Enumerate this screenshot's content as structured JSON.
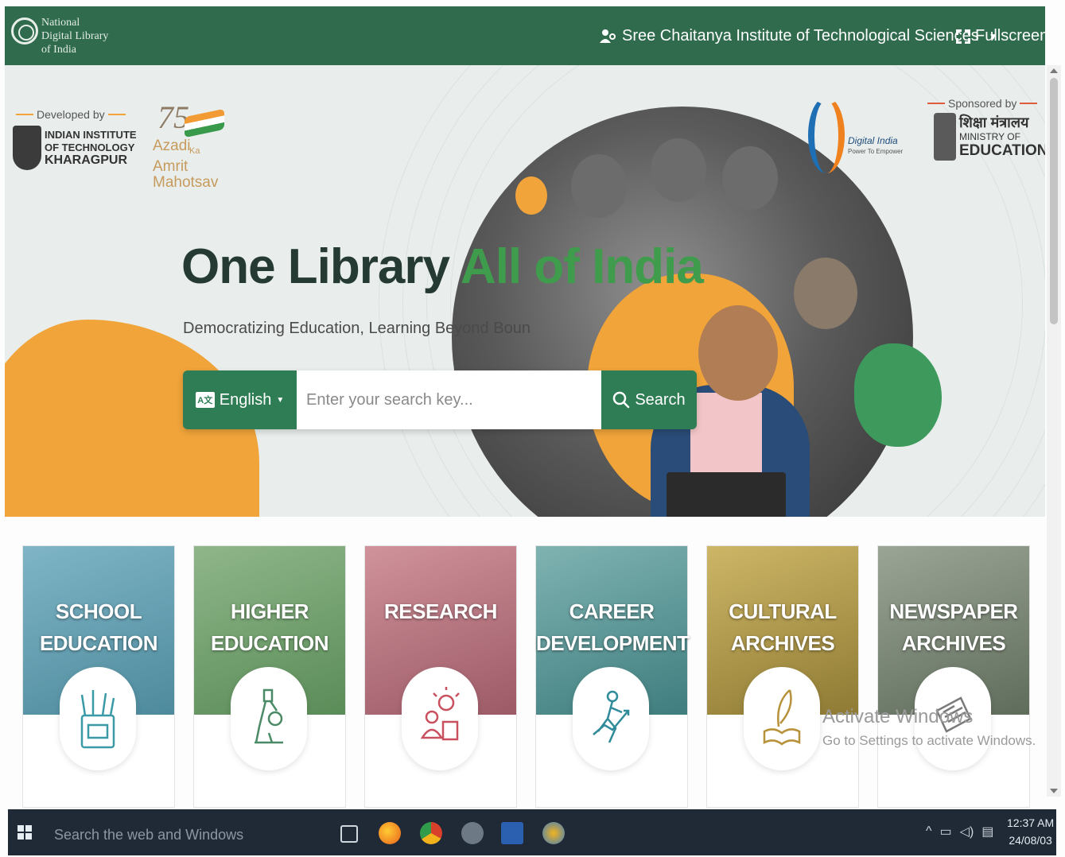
{
  "header": {
    "logo_lines": [
      "National",
      "Digital Library",
      "of India"
    ],
    "institution": "Sree Chaitanya Institute of Technological Sciences",
    "fullscreen_label": "Fullscreen"
  },
  "hero": {
    "developed_by": "Developed by",
    "iit_lines": [
      "INDIAN INSTITUTE",
      "OF TECHNOLOGY",
      "KHARAGPUR"
    ],
    "azadi_number": "75",
    "azadi_lines": [
      "Azadi",
      "Ka",
      "Amrit Mahotsav"
    ],
    "digital_india": "Digital India",
    "digital_india_sub": "Power To Empower",
    "sponsored_by": "Sponsored by",
    "moe_hindi": "शिक्षा मंत्रालय",
    "moe_lines": [
      "MINISTRY OF",
      "EDUCATION"
    ],
    "headline_part1": "One Library ",
    "headline_part2": "All of India",
    "tagline": "Democratizing Education, Learning Beyond Boun"
  },
  "search": {
    "language": "English",
    "placeholder": "Enter your search key...",
    "button_label": "Search"
  },
  "categories": [
    {
      "title": "SCHOOL\nEDUCATION",
      "icon": "stationery-icon",
      "color": "#5a98a8"
    },
    {
      "title": "HIGHER\nEDUCATION",
      "icon": "microscope-icon",
      "color": "#6f9a6a"
    },
    {
      "title": "RESEARCH",
      "icon": "research-icon",
      "color": "#b8707a"
    },
    {
      "title": "CAREER\nDEVELOPMENT",
      "icon": "career-icon",
      "color": "#4f8e8f"
    },
    {
      "title": "CULTURAL\nARCHIVES",
      "icon": "quill-book-icon",
      "color": "#b59a3c"
    },
    {
      "title": "NEWSPAPER\nARCHIVES",
      "icon": "newspaper-icon",
      "color": "#7d8c78"
    }
  ],
  "watermark": {
    "line1": "Activate Windows",
    "line2": "Go to Settings to activate Windows."
  },
  "taskbar": {
    "search_placeholder": "Search the web and Windows",
    "time": "12:37 AM",
    "date": "24/08/03"
  }
}
